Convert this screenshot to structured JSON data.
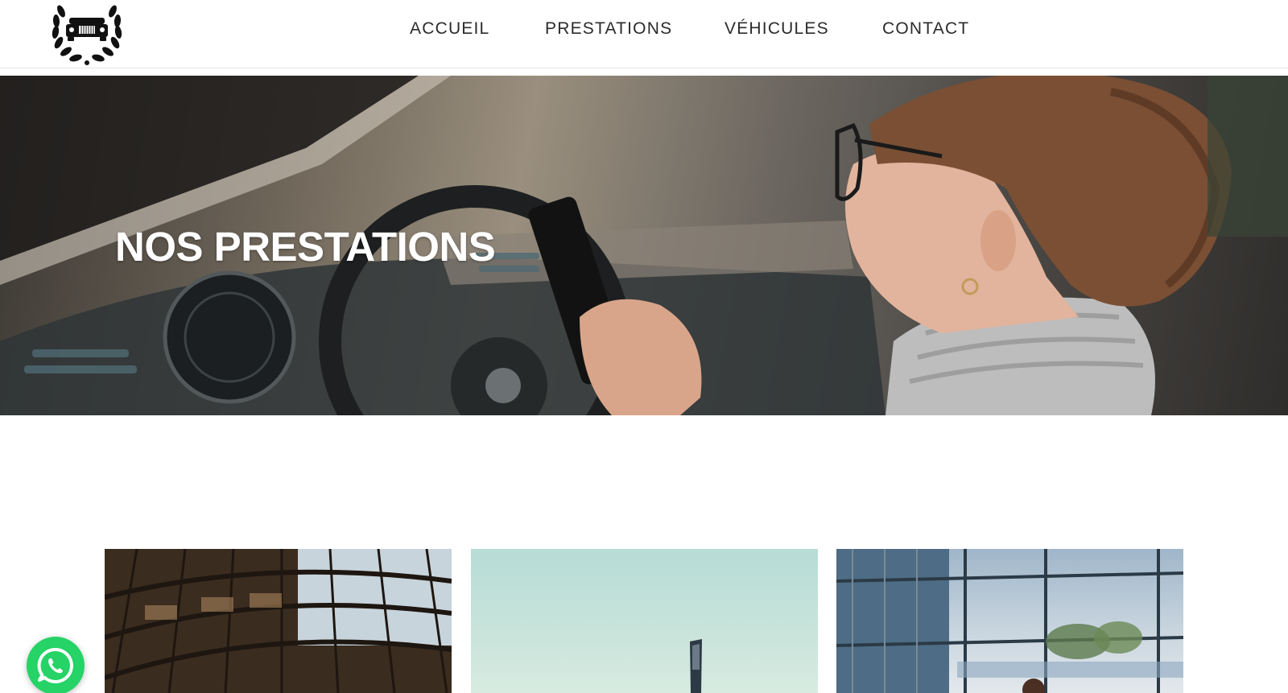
{
  "nav": {
    "items": [
      {
        "label": "ACCUEIL"
      },
      {
        "label": "PRESTATIONS"
      },
      {
        "label": "VÉHICULES"
      },
      {
        "label": "CONTACT"
      }
    ]
  },
  "hero": {
    "title": "NOS PRESTATIONS"
  },
  "icons": {
    "logo": "laurel-car-logo",
    "whatsapp": "whatsapp-icon"
  },
  "colors": {
    "whatsapp": "#25d366",
    "nav_text": "#2b2b2b",
    "hero_text": "#ffffff"
  }
}
